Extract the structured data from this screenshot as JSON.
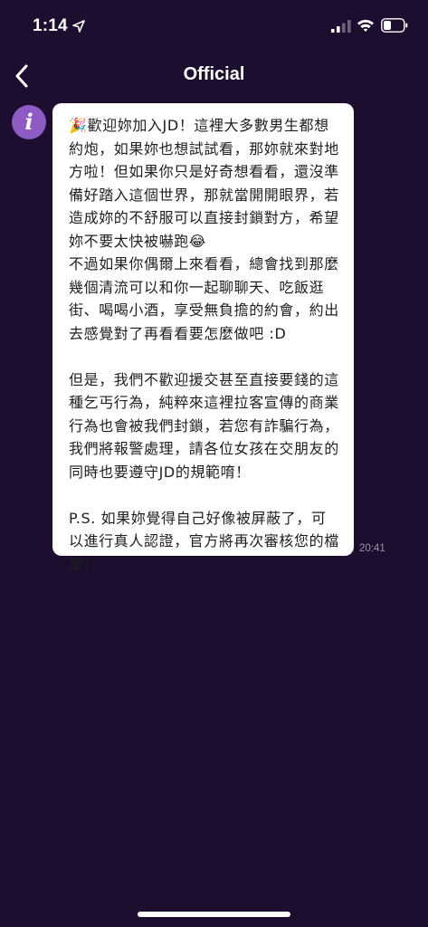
{
  "status_bar": {
    "time": "1:14",
    "icons": [
      "location-arrow-icon",
      "cellular-signal-icon",
      "wifi-icon",
      "battery-icon"
    ]
  },
  "nav": {
    "title": "Official",
    "back_icon": "chevron-left-icon"
  },
  "avatar": {
    "letter": "i",
    "color": "#8e5bc4"
  },
  "message": {
    "paragraphs": [
      "🎉歡迎妳加入JD！這裡大多數男生都想約炮，如果妳也想試試看，那妳就來對地方啦！但如果你只是好奇想看看，還沒準備好踏入這個世界，那就當開開眼界，若造成妳的不舒服可以直接封鎖對方，希望妳不要太快被嚇跑😂\n不過如果你偶爾上來看看，總會找到那麼幾個清流可以和你一起聊聊天、吃飯逛街、喝喝小酒，享受無負擔的約會，約出去感覺對了再看看要怎麼做吧 :D",
      "但是，我們不歡迎援交甚至直接要錢的這種乞丐行為，純粹來這裡拉客宣傳的商業行為也會被我們封鎖，若您有詐騙行為，我們將報警處理，請各位女孩在交朋友的同時也要遵守JD的規範唷！",
      "P.S. 如果妳覺得自己好像被屏蔽了，可以進行真人認證，官方將再次審核您的檔案！"
    ],
    "time": "20:41"
  },
  "colors": {
    "background": "#1d0d2e",
    "bubble": "#ffffff",
    "text": "#1e1e1e",
    "timestamp": "#9a92a6"
  }
}
